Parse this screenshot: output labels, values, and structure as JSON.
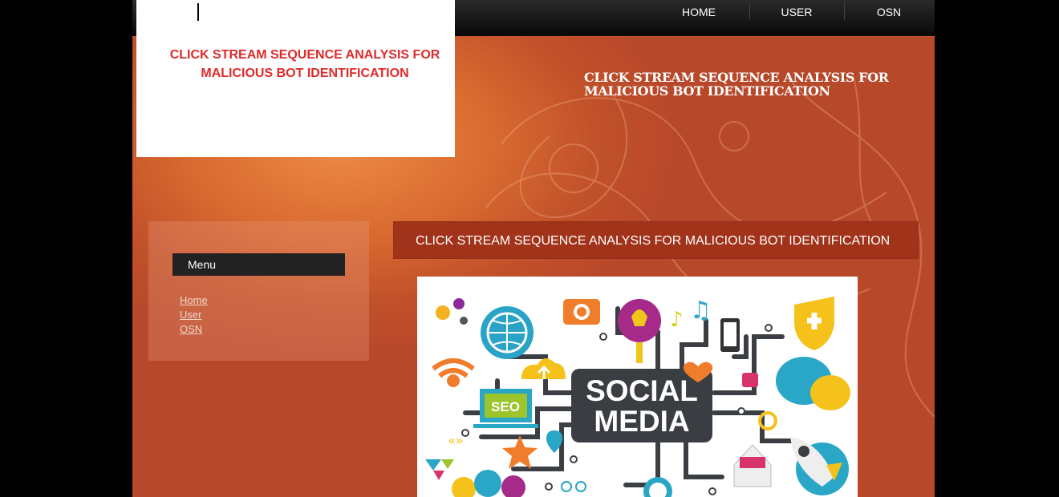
{
  "nav": {
    "items": [
      {
        "label": "HOME"
      },
      {
        "label": "USER"
      },
      {
        "label": "OSN"
      }
    ]
  },
  "logo": {
    "text": "CLICK STREAM SEQUENCE ANALYSIS FOR MALICIOUS BOT IDENTIFICATION"
  },
  "header": {
    "title": "CLICK STREAM SEQUENCE ANALYSIS FOR MALICIOUS BOT IDENTIFICATION"
  },
  "sidebar": {
    "menu_title": "Menu",
    "links": [
      {
        "label": "Home"
      },
      {
        "label": "User"
      },
      {
        "label": "OSN"
      }
    ]
  },
  "content": {
    "title": "CLICK STREAM SEQUENCE ANALYSIS FOR MALICIOUS BOT IDENTIFICATION",
    "image": {
      "line1": "SOCIAL",
      "line2": "MEDIA",
      "badge": "SEO"
    }
  },
  "colors": {
    "logo_text": "#e02a2a",
    "banner": "#a1331a",
    "page_bg": "#c2522a",
    "topbar": "#080808"
  }
}
